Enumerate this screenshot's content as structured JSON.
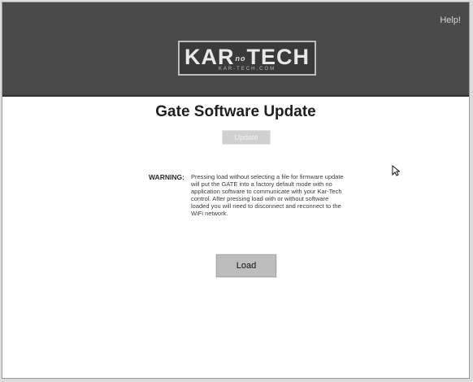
{
  "header": {
    "help_link": "Help!",
    "logo": {
      "word_left": "KAR",
      "word_mid": "no",
      "word_right": "TECH",
      "url": "KAR-TECH.COM"
    }
  },
  "main": {
    "title": "Gate Software Update",
    "update_button_label": "Update",
    "warning_label": "WARNING:",
    "warning_text": "Pressing load without selecting a file for firmware update will put the GATE into a factory default mode with no application software to communicate with your Kar-Tech control. After pressing load with or without software loaded you will need to disconnect and reconnect to the WiFi network.",
    "load_button_label": "Load"
  },
  "colors": {
    "header_bg": "#4a4a4a",
    "page_bg": "#ffffff",
    "button_bg": "#bdbdbd"
  },
  "icons": {
    "cursor": "mouse-pointer-icon"
  }
}
